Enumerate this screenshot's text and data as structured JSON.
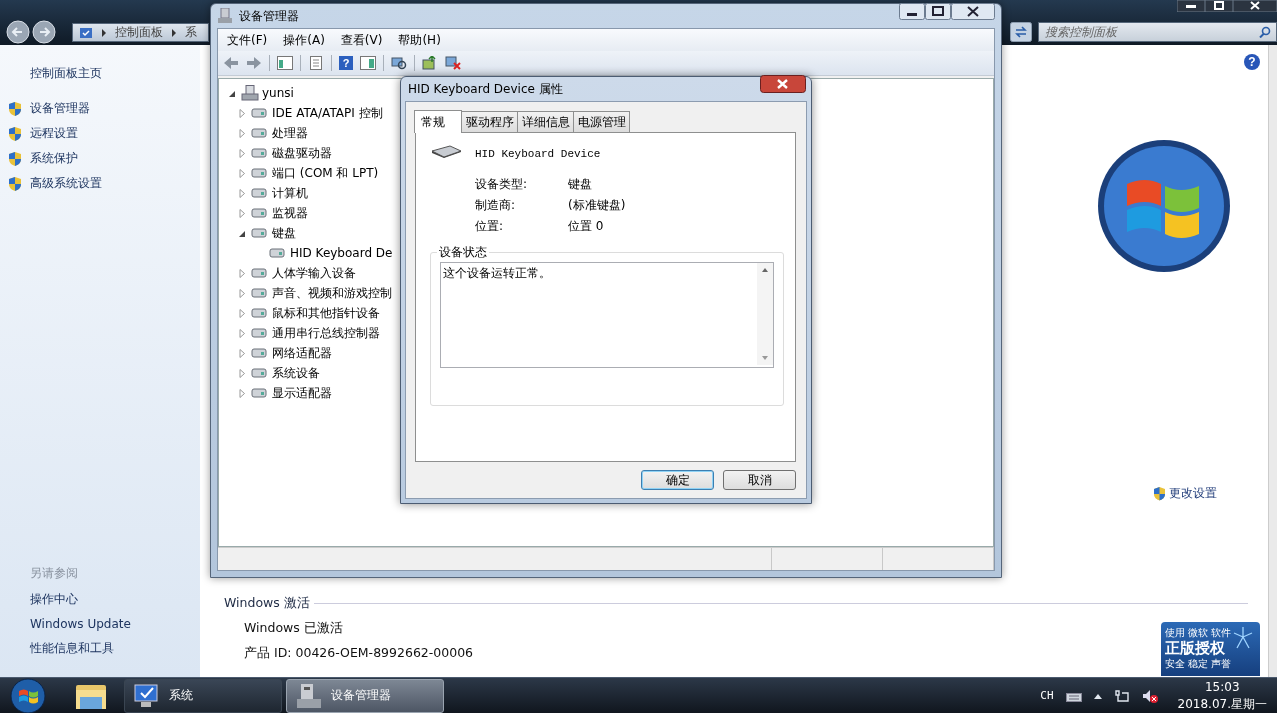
{
  "control_panel": {
    "breadcrumb": [
      "控制面板",
      "系"
    ],
    "search": {
      "placeholder": "搜索控制面板"
    },
    "sidebar": {
      "home": "控制面板主页",
      "tasks": [
        "设备管理器",
        "远程设置",
        "系统保护",
        "高级系统设置"
      ],
      "see_also_title": "另请参阅",
      "see_also": [
        "操作中心",
        "Windows Update",
        "性能信息和工具"
      ]
    },
    "help_glyph": "?",
    "change_settings": "更改设置",
    "activation": {
      "title": "Windows 激活",
      "status": "Windows 已激活",
      "product_id": "产品 ID: 00426-OEM-8992662-00006"
    },
    "genuine_badge": {
      "line1": "使用 微软 软件",
      "line2": "正版授权",
      "line3": "安全 稳定 声誉"
    }
  },
  "device_manager": {
    "title": "设备管理器",
    "menu": [
      "文件(F)",
      "操作(A)",
      "查看(V)",
      "帮助(H)"
    ],
    "toolbar_help_glyph": "?",
    "tree": {
      "label": "yunsi",
      "expanded": true,
      "children": [
        {
          "label": "IDE ATA/ATAPI 控制",
          "expanded": false
        },
        {
          "label": "处理器",
          "expanded": false
        },
        {
          "label": "磁盘驱动器",
          "expanded": false
        },
        {
          "label": "端口 (COM 和 LPT)",
          "expanded": false
        },
        {
          "label": "计算机",
          "expanded": false
        },
        {
          "label": "监视器",
          "expanded": false
        },
        {
          "label": "键盘",
          "expanded": true,
          "children": [
            {
              "label": "HID Keyboard De"
            }
          ]
        },
        {
          "label": "人体学输入设备",
          "expanded": false
        },
        {
          "label": "声音、视频和游戏控制",
          "expanded": false
        },
        {
          "label": "鼠标和其他指针设备",
          "expanded": false
        },
        {
          "label": "通用串行总线控制器",
          "expanded": false
        },
        {
          "label": "网络适配器",
          "expanded": false
        },
        {
          "label": "系统设备",
          "expanded": false
        },
        {
          "label": "显示适配器",
          "expanded": false
        }
      ]
    }
  },
  "dialog": {
    "title": "HID Keyboard Device 属性",
    "tabs": [
      {
        "label": "常规",
        "selected": true
      },
      {
        "label": "驱动程序",
        "selected": false
      },
      {
        "label": "详细信息",
        "selected": false
      },
      {
        "label": "电源管理",
        "selected": false
      }
    ],
    "device_name": "HID Keyboard Device",
    "properties": [
      {
        "label": "设备类型:",
        "value": "键盘"
      },
      {
        "label": "制造商:",
        "value": "(标准键盘)"
      },
      {
        "label": "位置:",
        "value": "位置 0"
      }
    ],
    "status_title": "设备状态",
    "status_text": "这个设备运转正常。",
    "buttons": [
      {
        "label": "确定",
        "default": true
      },
      {
        "label": "取消",
        "default": false
      }
    ]
  },
  "taskbar": {
    "buttons": [
      {
        "label": "系统",
        "selected": false
      },
      {
        "label": "设备管理器",
        "selected": true
      }
    ],
    "language": "CH",
    "time": "15:03",
    "date": "2018.07.星期一"
  }
}
